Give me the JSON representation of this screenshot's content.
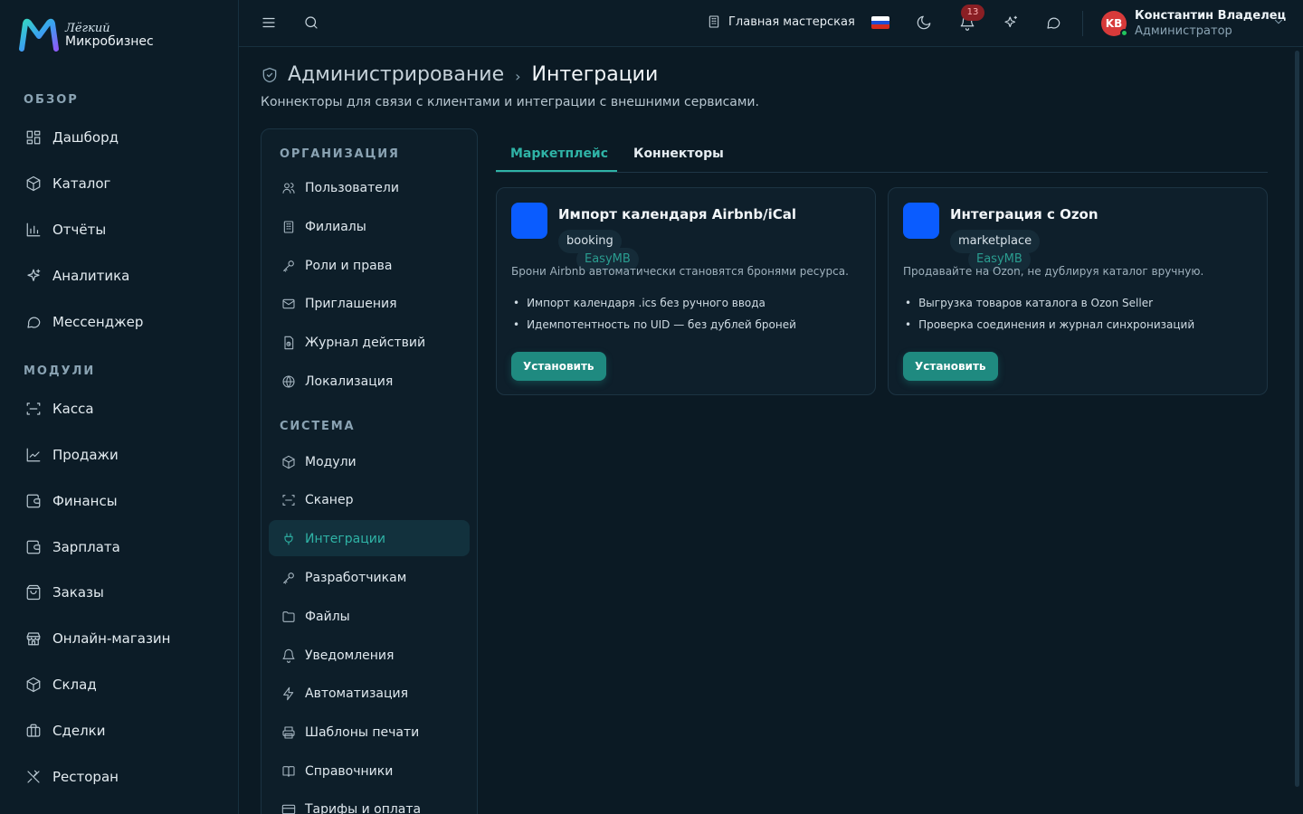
{
  "brand": {
    "sub": "Лёгкий",
    "main": "Микробизнес"
  },
  "sidebar": {
    "sections": [
      {
        "label": "ОБЗОР"
      },
      {
        "label": "МОДУЛИ"
      }
    ],
    "items": [
      {
        "label": "Дашборд",
        "icon": "dashboard-icon"
      },
      {
        "label": "Каталог",
        "icon": "catalog-icon"
      },
      {
        "label": "Отчёты",
        "icon": "reports-icon"
      },
      {
        "label": "Аналитика",
        "icon": "sparkles-icon"
      },
      {
        "label": "Мессенджер",
        "icon": "chat-icon"
      },
      {
        "label": "Касса",
        "icon": "scan-icon"
      },
      {
        "label": "Продажи",
        "icon": "trend-icon"
      },
      {
        "label": "Финансы",
        "icon": "wallet-icon"
      },
      {
        "label": "Зарплата",
        "icon": "wallet-icon"
      },
      {
        "label": "Заказы",
        "icon": "orders-icon"
      },
      {
        "label": "Онлайн-магазин",
        "icon": "store-icon"
      },
      {
        "label": "Склад",
        "icon": "box-icon"
      },
      {
        "label": "Сделки",
        "icon": "briefcase-icon"
      },
      {
        "label": "Ресторан",
        "icon": "utensils-icon"
      }
    ]
  },
  "topbar": {
    "workshop": "Главная мастерская",
    "notifications_count": "13",
    "user": {
      "initials": "KB",
      "name": "Константин Владелец",
      "role": "Администратор"
    }
  },
  "page": {
    "crumb_parent": "Администрирование",
    "crumb_current": "Интеграции",
    "description": "Коннекторы для связи с клиентами и интеграции с внешними сервисами."
  },
  "settings_nav": {
    "org_label": "ОРГАНИЗАЦИЯ",
    "system_label": "СИСТЕМА",
    "items": [
      {
        "label": "Пользователи"
      },
      {
        "label": "Филиалы"
      },
      {
        "label": "Роли и права"
      },
      {
        "label": "Приглашения"
      },
      {
        "label": "Журнал действий"
      },
      {
        "label": "Локализация"
      },
      {
        "label": "Модули"
      },
      {
        "label": "Сканер"
      },
      {
        "label": "Интеграции"
      },
      {
        "label": "Разработчикам"
      },
      {
        "label": "Файлы"
      },
      {
        "label": "Уведомления"
      },
      {
        "label": "Автоматизация"
      },
      {
        "label": "Шаблоны печати"
      },
      {
        "label": "Справочники"
      },
      {
        "label": "Тарифы и оплата"
      }
    ]
  },
  "tabs": [
    {
      "label": "Маркетплейс"
    },
    {
      "label": "Коннекторы"
    }
  ],
  "cards": [
    {
      "title": "Импорт календаря Airbnb/iCal",
      "tags": [
        "EasyMB",
        "booking"
      ],
      "description": "Брони Airbnb автоматически становятся бронями ресурса.",
      "features": [
        "Импорт календаря .ics без ручного ввода",
        "Идемпотентность по UID — без дублей броней"
      ],
      "button": "Установить"
    },
    {
      "title": "Интеграция с Ozon",
      "tags": [
        "EasyMB",
        "marketplace"
      ],
      "description": "Продавайте на Ozon, не дублируя каталог вручную.",
      "features": [
        "Выгрузка товаров каталога в Ozon Seller",
        "Проверка соединения и журнал синхронизаций"
      ],
      "button": "Установить"
    }
  ],
  "colors": {
    "accent": "#2fb3a6",
    "button": "#1f8a80",
    "logo_tile": "#0a5cff",
    "badge": "#8a1f24"
  }
}
